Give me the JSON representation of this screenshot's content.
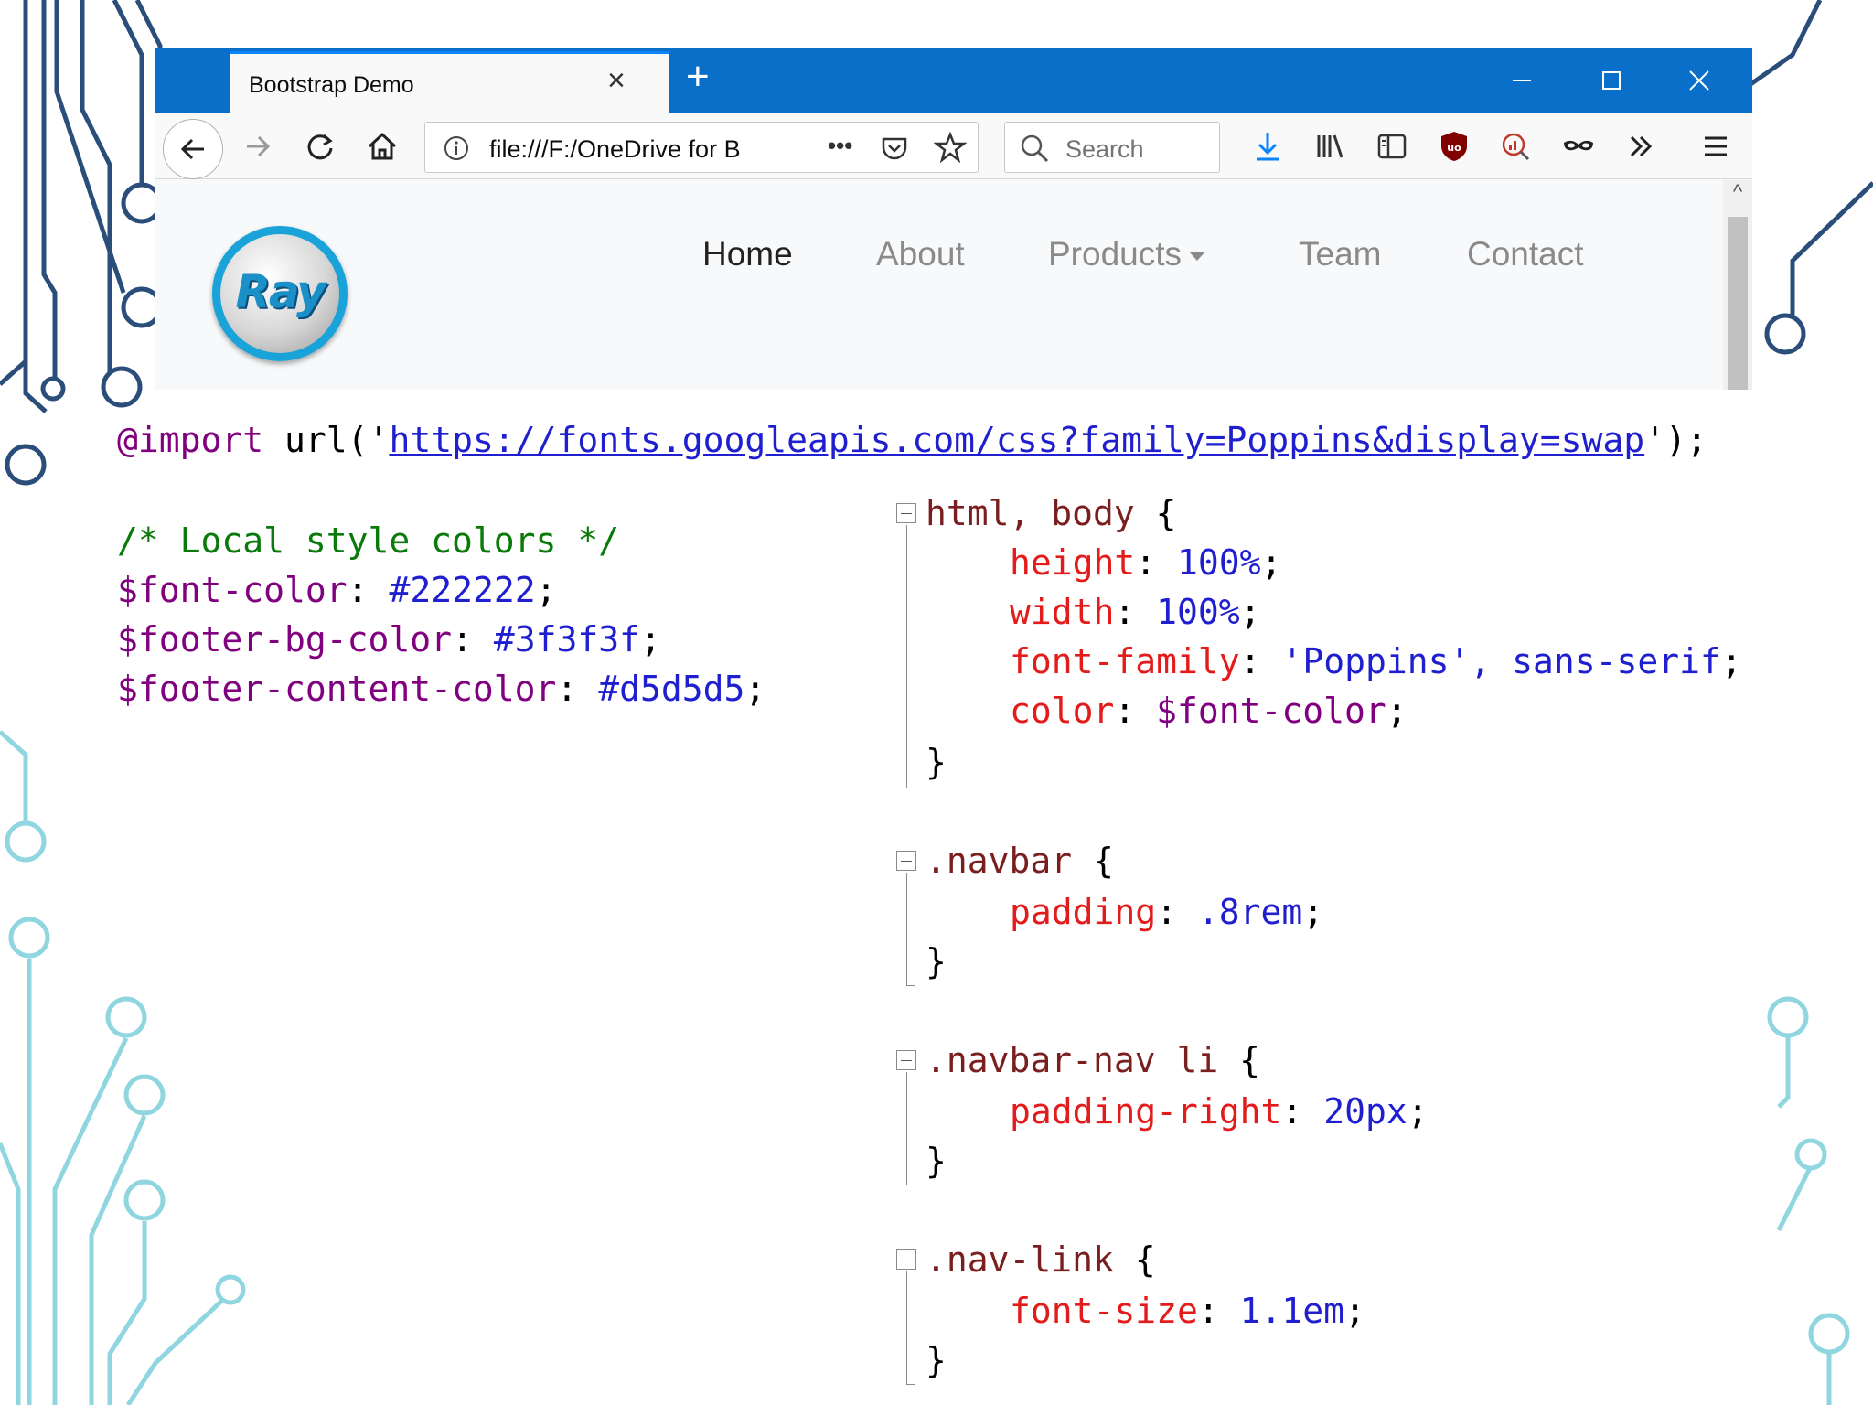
{
  "browser": {
    "tab_title": "Bootstrap Demo",
    "tab_close": "×",
    "new_tab": "+",
    "url": "file:///F:/OneDrive for B",
    "search_placeholder": "Search",
    "page_actions": "•••"
  },
  "site": {
    "logo_text": "Ray",
    "nav": [
      {
        "label": "Home"
      },
      {
        "label": "About"
      },
      {
        "label": "Products"
      },
      {
        "label": "Team"
      },
      {
        "label": "Contact"
      }
    ]
  },
  "code": {
    "import_line": {
      "keyword": "@import",
      "func_open": " url('",
      "url": "https://fonts.googleapis.com/css?family=Poppins&display=swap",
      "func_close": "');"
    },
    "comment": "/* Local style colors */",
    "variables": [
      {
        "name": "$font-color",
        "value": "#222222"
      },
      {
        "name": "$footer-bg-color",
        "value": "#3f3f3f"
      },
      {
        "name": "$footer-content-color",
        "value": "#d5d5d5"
      }
    ],
    "rules": [
      {
        "selector": "html, body",
        "decls": [
          {
            "prop": "height",
            "value": "100%"
          },
          {
            "prop": "width",
            "value": "100%"
          },
          {
            "prop": "font-family",
            "value": "'Poppins', sans-serif"
          },
          {
            "prop": "color",
            "value": "$font-color"
          }
        ]
      },
      {
        "selector": ".navbar",
        "decls": [
          {
            "prop": "padding",
            "value": ".8rem"
          }
        ]
      },
      {
        "selector": ".navbar-nav li",
        "decls": [
          {
            "prop": "padding-right",
            "value": "20px"
          }
        ]
      },
      {
        "selector": ".nav-link",
        "decls": [
          {
            "prop": "font-size",
            "value": "1.1em"
          }
        ]
      }
    ]
  },
  "colors": {
    "titlebar": "#0a6fc9",
    "circuit_dark": "#2a4d7a",
    "circuit_light": "#8fd6e0",
    "property": "#e31b1b",
    "value": "#1f1fd0",
    "variable": "#800080",
    "comment": "#0a7a0a"
  }
}
